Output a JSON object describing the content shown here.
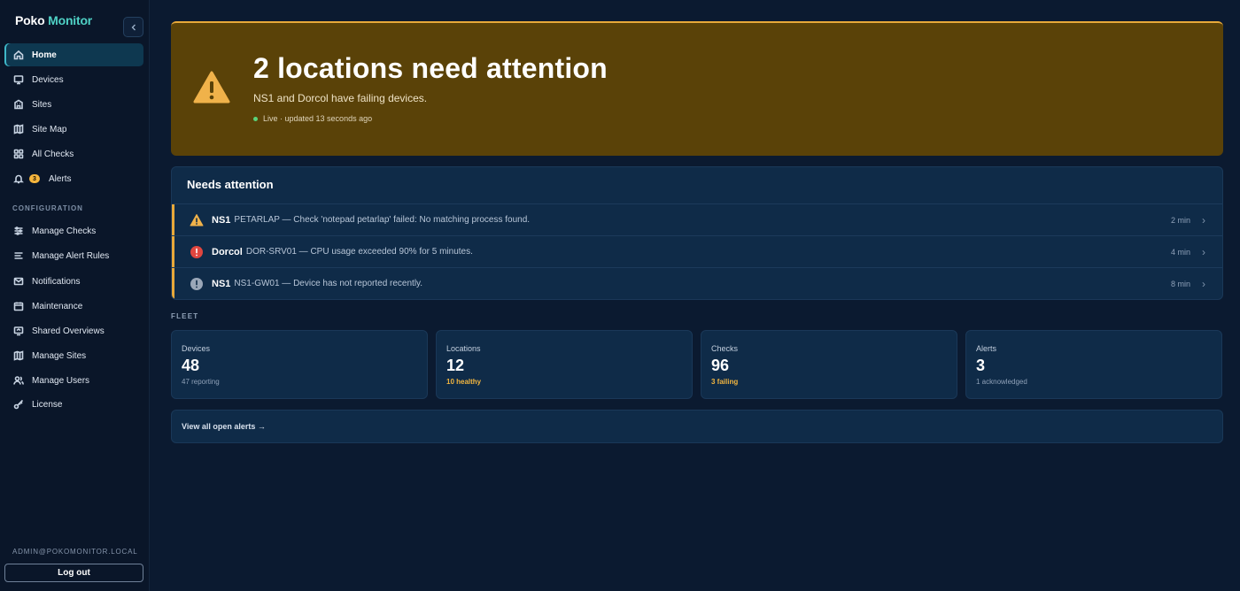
{
  "brand": {
    "part1": "Poko",
    "part2": "Monitor"
  },
  "sidebar": {
    "collapse_icon": "chevron-left-icon",
    "nav": [
      {
        "label": "Home",
        "icon": "home-icon",
        "active": true
      },
      {
        "label": "Devices",
        "icon": "monitor-icon"
      },
      {
        "label": "Sites",
        "icon": "building-icon"
      },
      {
        "label": "Site Map",
        "icon": "map-icon"
      },
      {
        "label": "All Checks",
        "icon": "grid-icon"
      },
      {
        "label": "Alerts",
        "icon": "bell-icon",
        "badge": "3"
      }
    ],
    "section_label": "CONFIGURATION",
    "config": [
      {
        "label": "Manage Checks",
        "icon": "sliders-icon"
      },
      {
        "label": "Manage Alert Rules",
        "icon": "list-icon"
      },
      {
        "label": "Notifications",
        "icon": "mail-icon"
      },
      {
        "label": "Maintenance",
        "icon": "calendar-icon"
      },
      {
        "label": "Shared Overviews",
        "icon": "share-screen-icon"
      },
      {
        "label": "Manage Sites",
        "icon": "map-icon"
      },
      {
        "label": "Manage Users",
        "icon": "users-icon"
      },
      {
        "label": "License",
        "icon": "key-icon"
      }
    ],
    "user_email": "ADMIN@POKOMONITOR.LOCAL",
    "logout_label": "Log out"
  },
  "hero": {
    "title": "2 locations need attention",
    "subtitle": "NS1 and Dorcol have failing devices.",
    "live_text": "Live · updated 13 seconds ago",
    "accent": "#e8a93a"
  },
  "attention": {
    "title": "Needs attention",
    "rows": [
      {
        "severity": "warning",
        "icon": "warning-triangle-icon",
        "site": "NS1",
        "message": "PETARLAP — Check 'notepad petarlap' failed: No matching process found.",
        "time": "2 min"
      },
      {
        "severity": "critical",
        "icon": "error-circle-icon",
        "site": "Dorcol",
        "message": "DOR-SRV01 — CPU usage exceeded 90% for 5 minutes.",
        "time": "4 min"
      },
      {
        "severity": "info",
        "icon": "info-circle-icon",
        "site": "NS1",
        "message": "NS1-GW01 — Device has not reported recently.",
        "time": "8 min"
      }
    ]
  },
  "fleet": {
    "label": "FLEET",
    "cards": [
      {
        "label": "Devices",
        "value": "48",
        "sub": "47 reporting",
        "warn": false
      },
      {
        "label": "Locations",
        "value": "12",
        "sub": "10 healthy",
        "warn": true
      },
      {
        "label": "Checks",
        "value": "96",
        "sub": "3 failing",
        "warn": true
      },
      {
        "label": "Alerts",
        "value": "3",
        "sub": "1 acknowledged",
        "warn": false
      }
    ]
  },
  "view_all_label": "View all open alerts →"
}
